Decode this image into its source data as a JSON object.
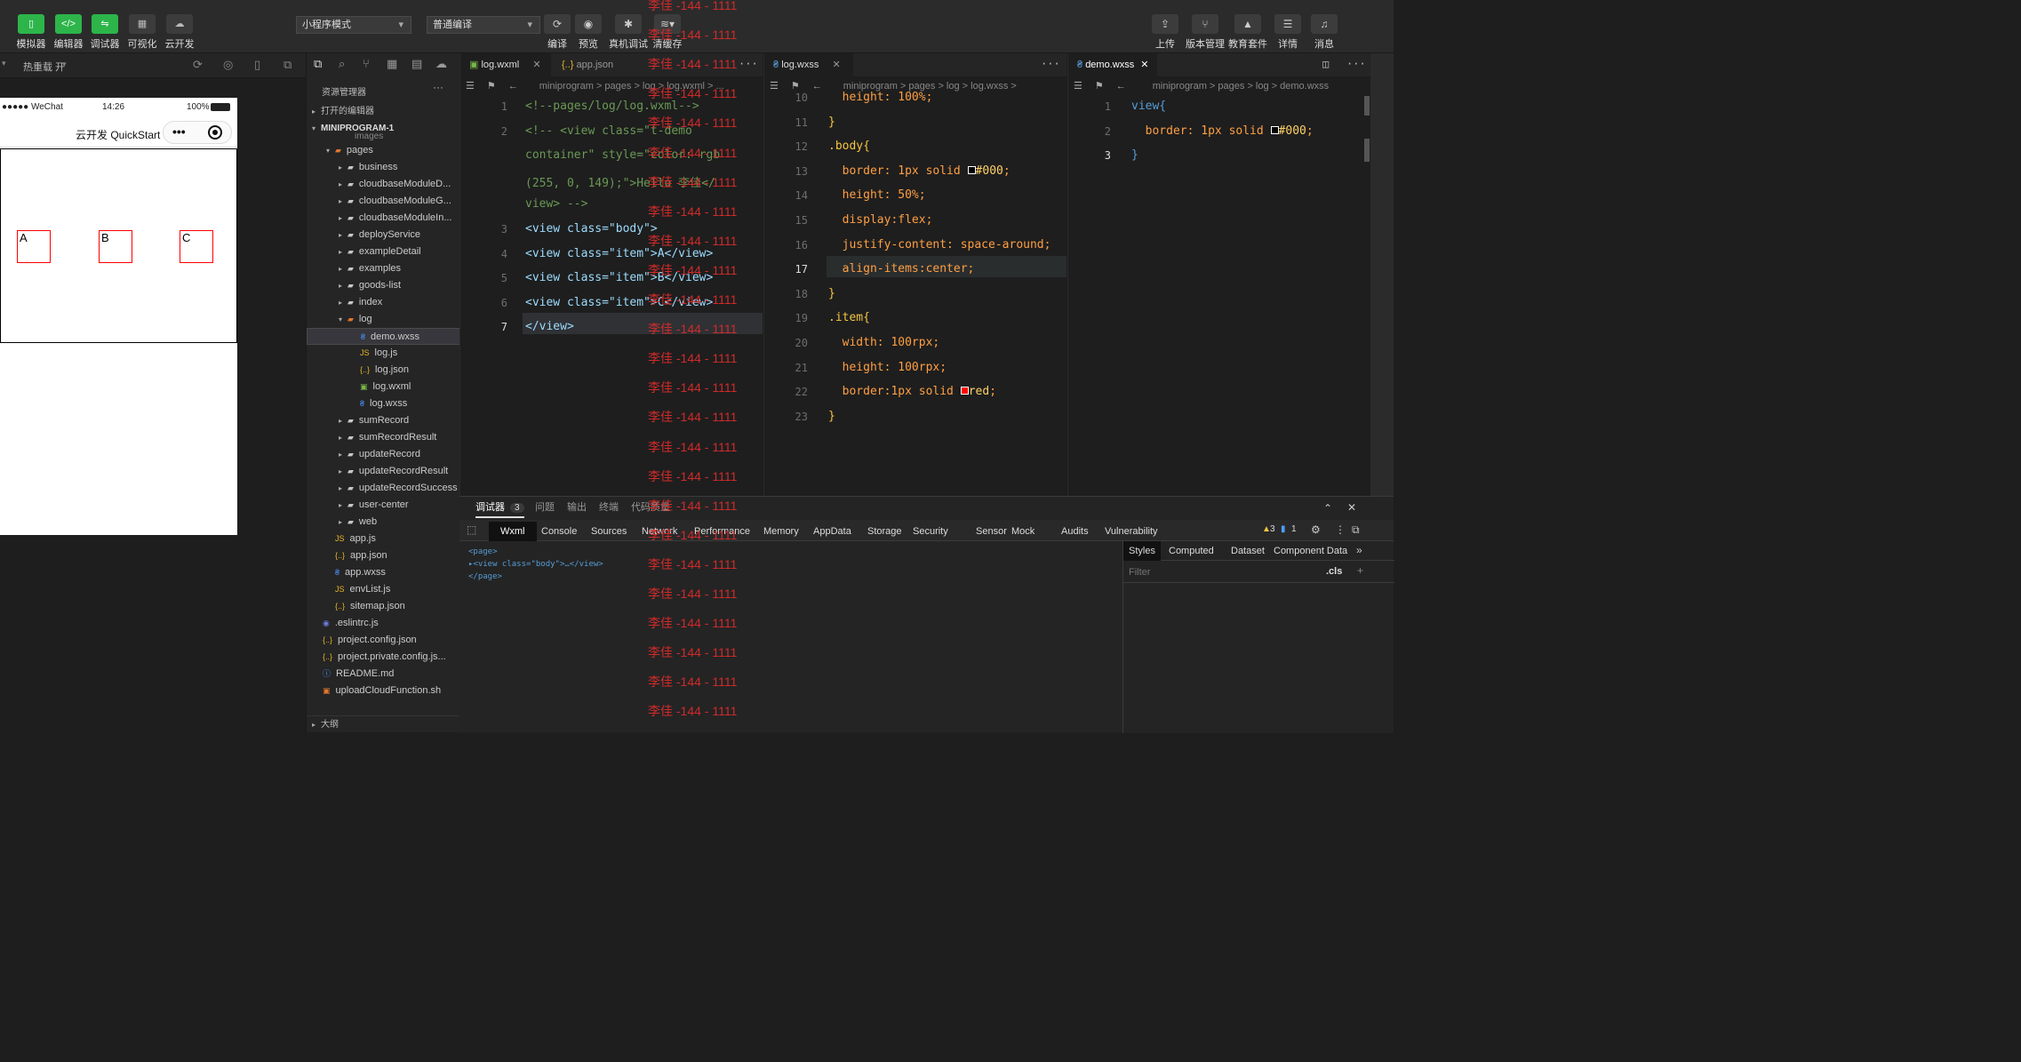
{
  "toolbar": {
    "left_buttons": [
      {
        "label": "模拟器",
        "icon": "phone-icon"
      },
      {
        "label": "编辑器",
        "icon": "code-icon"
      },
      {
        "label": "调试器",
        "icon": "debug-icon"
      },
      {
        "label": "可视化",
        "icon": "layout-icon"
      },
      {
        "label": "云开发",
        "icon": "cloud-icon"
      }
    ],
    "mode_select": "小程序模式",
    "compile_select": "普通编译",
    "mid_buttons": [
      {
        "label": "编译",
        "icon": "refresh-icon"
      },
      {
        "label": "预览",
        "icon": "eye-icon"
      },
      {
        "label": "真机调试",
        "icon": "bug-icon"
      },
      {
        "label": "清缓存",
        "icon": "layers-icon"
      }
    ],
    "right_buttons": [
      {
        "label": "上传",
        "icon": "upload-icon"
      },
      {
        "label": "版本管理",
        "icon": "branch-icon"
      },
      {
        "label": "教育套件",
        "icon": "graduation-icon"
      },
      {
        "label": "详情",
        "icon": "menu-icon"
      },
      {
        "label": "消息",
        "icon": "bell-icon"
      }
    ]
  },
  "simulator": {
    "hot_reload": "热重载 开",
    "status_bar": {
      "carrier": "●●●●● WeChat",
      "time": "14:26",
      "battery": "100%"
    },
    "nav_title": "云开发 QuickStart",
    "boxes": [
      "A",
      "B",
      "C"
    ]
  },
  "explorer": {
    "title": "资源管理器",
    "open_editors": "打开的编辑器",
    "project": "MINIPROGRAM-1",
    "partial_folder": "images",
    "items": [
      {
        "name": "pages",
        "type": "folder-open",
        "depth": 1
      },
      {
        "name": "business",
        "type": "folder",
        "depth": 2
      },
      {
        "name": "cloudbaseModuleD...",
        "type": "folder",
        "depth": 2
      },
      {
        "name": "cloudbaseModuleG...",
        "type": "folder",
        "depth": 2
      },
      {
        "name": "cloudbaseModuleIn...",
        "type": "folder",
        "depth": 2
      },
      {
        "name": "deployService",
        "type": "folder",
        "depth": 2
      },
      {
        "name": "exampleDetail",
        "type": "folder",
        "depth": 2
      },
      {
        "name": "examples",
        "type": "folder",
        "depth": 2
      },
      {
        "name": "goods-list",
        "type": "folder",
        "depth": 2
      },
      {
        "name": "index",
        "type": "folder",
        "depth": 2
      },
      {
        "name": "log",
        "type": "folder-open",
        "depth": 2
      },
      {
        "name": "demo.wxss",
        "type": "wxss",
        "depth": 3
      },
      {
        "name": "log.js",
        "type": "js",
        "depth": 3
      },
      {
        "name": "log.json",
        "type": "json",
        "depth": 3
      },
      {
        "name": "log.wxml",
        "type": "wxml",
        "depth": 3
      },
      {
        "name": "log.wxss",
        "type": "wxss",
        "depth": 3
      },
      {
        "name": "sumRecord",
        "type": "folder",
        "depth": 2
      },
      {
        "name": "sumRecordResult",
        "type": "folder",
        "depth": 2
      },
      {
        "name": "updateRecord",
        "type": "folder",
        "depth": 2
      },
      {
        "name": "updateRecordResult",
        "type": "folder",
        "depth": 2
      },
      {
        "name": "updateRecordSuccess",
        "type": "folder",
        "depth": 2
      },
      {
        "name": "user-center",
        "type": "folder",
        "depth": 2
      },
      {
        "name": "web",
        "type": "folder",
        "depth": 2
      },
      {
        "name": "app.js",
        "type": "js",
        "depth": 1
      },
      {
        "name": "app.json",
        "type": "json",
        "depth": 1
      },
      {
        "name": "app.wxss",
        "type": "wxss",
        "depth": 1
      },
      {
        "name": "envList.js",
        "type": "js",
        "depth": 1
      },
      {
        "name": "sitemap.json",
        "type": "json",
        "depth": 1
      },
      {
        "name": ".eslintrc.js",
        "type": "eslint",
        "depth": 0
      },
      {
        "name": "project.config.json",
        "type": "json",
        "depth": 0
      },
      {
        "name": "project.private.config.js...",
        "type": "json",
        "depth": 0
      },
      {
        "name": "README.md",
        "type": "info",
        "depth": 0
      },
      {
        "name": "uploadCloudFunction.sh",
        "type": "sh",
        "depth": 0
      }
    ],
    "outline": "大纲"
  },
  "editor1": {
    "tabs": [
      {
        "label": "log.wxml",
        "active": true
      },
      {
        "label": "app.json",
        "active": false
      }
    ],
    "breadcrumb": "miniprogram > pages > log > log.wxml > ...",
    "lines": [
      {
        "n": "1",
        "text": "<!--pages/log/log.wxml-->"
      },
      {
        "n": "2",
        "text": "<!-- <view class=\"t-demo"
      },
      {
        "n": "",
        "text": "container\" style=\"color: rgb"
      },
      {
        "n": "",
        "text": "(255, 0, 149);\">Hello 李佳</"
      },
      {
        "n": "",
        "text": "view> -->"
      },
      {
        "n": "3",
        "text": "<view class=\"body\">"
      },
      {
        "n": "4",
        "text": "<view class=\"item\">A</view>"
      },
      {
        "n": "5",
        "text": "<view class=\"item\">B</view>"
      },
      {
        "n": "6",
        "text": "<view class=\"item\">C</view>"
      },
      {
        "n": "7",
        "text": "</view>"
      }
    ],
    "watermark": "李佳 -144 - 1111"
  },
  "editor2": {
    "tabs": [
      {
        "label": "log.wxss",
        "active": true
      }
    ],
    "breadcrumb": "miniprogram > pages > log > log.wxss >",
    "lines": [
      {
        "n": "10",
        "text": "  height: 100%;"
      },
      {
        "n": "11",
        "text": "}"
      },
      {
        "n": "12",
        "text": ".body{"
      },
      {
        "n": "13",
        "text": "  border: 1px solid ■#000;"
      },
      {
        "n": "14",
        "text": "  height: 50%;"
      },
      {
        "n": "15",
        "text": "  display:flex;"
      },
      {
        "n": "16",
        "text": "  justify-content: space-around;"
      },
      {
        "n": "17",
        "text": "  align-items:center;"
      },
      {
        "n": "18",
        "text": "}"
      },
      {
        "n": "19",
        "text": ".item{"
      },
      {
        "n": "20",
        "text": "  width: 100rpx;"
      },
      {
        "n": "21",
        "text": "  height: 100rpx;"
      },
      {
        "n": "22",
        "text": "  border:1px solid ■red;"
      },
      {
        "n": "23",
        "text": "}"
      }
    ]
  },
  "editor3": {
    "tabs": [
      {
        "label": "demo.wxss",
        "active": true
      }
    ],
    "breadcrumb": "miniprogram > pages > log > demo.wxss",
    "lines": [
      {
        "n": "1",
        "text": "view{"
      },
      {
        "n": "2",
        "text": "  border: 1px solid ■#000;"
      },
      {
        "n": "3",
        "text": "}"
      }
    ]
  },
  "devtools": {
    "top_tabs": [
      {
        "label": "调试器",
        "badge": "3"
      },
      {
        "label": "问题"
      },
      {
        "label": "输出"
      },
      {
        "label": "终端"
      },
      {
        "label": "代码质量"
      }
    ],
    "inner_tabs": [
      "Wxml",
      "Console",
      "Sources",
      "Network",
      "Performance",
      "Memory",
      "AppData",
      "Storage",
      "Security",
      "Sensor",
      "Mock",
      "Audits",
      "Vulnerability"
    ],
    "warn_count": "3",
    "info_count": "1",
    "tree": [
      "<page>",
      "▸<view class=\"body\">…</view>",
      "</page>"
    ],
    "side_tabs": [
      "Styles",
      "Computed",
      "Dataset",
      "Component Data"
    ],
    "filter_placeholder": "Filter",
    "cls": ".cls"
  },
  "colors": {
    "accent": "#2db54a",
    "watermark": "#d12a2a",
    "tag": "#569cd6"
  }
}
